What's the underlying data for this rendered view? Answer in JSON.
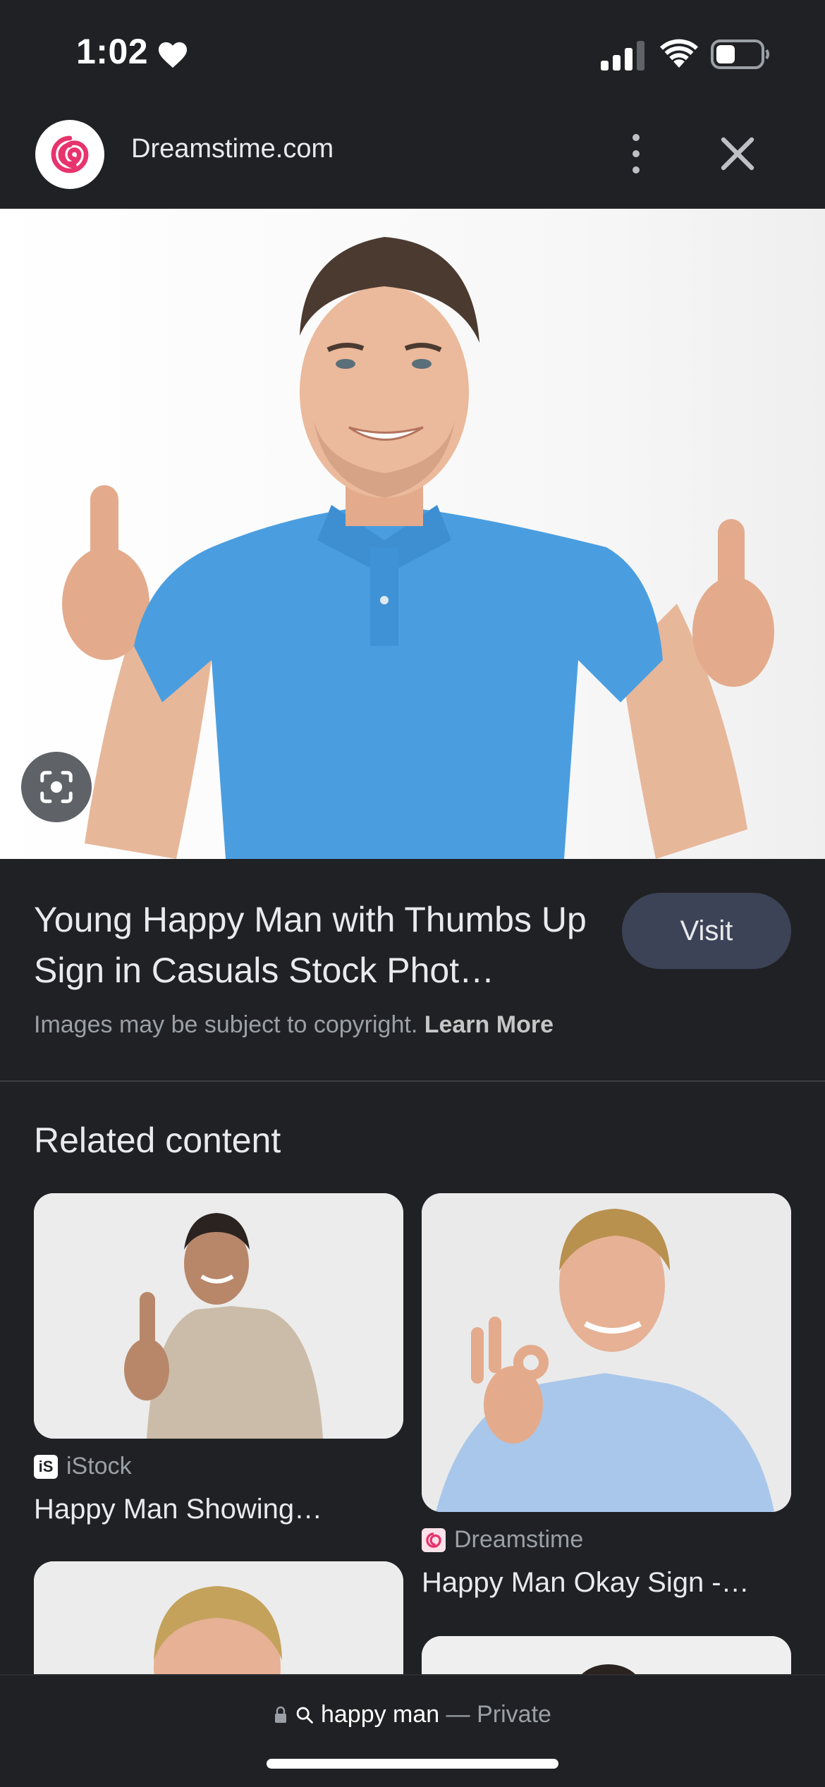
{
  "status": {
    "time": "1:02"
  },
  "header": {
    "site_name": "Dreamstime.com"
  },
  "result": {
    "title": "Young Happy Man with Thumbs Up Sign in Casuals Stock Phot…",
    "visit_label": "Visit",
    "copyright_text": "Images may be subject to copyright.",
    "learn_more_label": "Learn More"
  },
  "related": {
    "heading": "Related content",
    "items": [
      {
        "source": "iStock",
        "caption": "Happy Man Showing…"
      },
      {
        "source": "Dreamstime",
        "caption": "Happy Man Okay Sign -…"
      }
    ]
  },
  "address_bar": {
    "query": "happy man",
    "mode": "Private",
    "separator": "—"
  },
  "colors": {
    "background": "#202124",
    "visit_button": "#3c4357",
    "dreamstime_pink": "#e8336d"
  },
  "icons": [
    "heart-icon",
    "signal-icon",
    "wifi-icon",
    "battery-icon",
    "dreamstime-logo",
    "more-vert-icon",
    "close-icon",
    "lens-icon",
    "istock-icon",
    "lock-icon",
    "search-icon"
  ]
}
